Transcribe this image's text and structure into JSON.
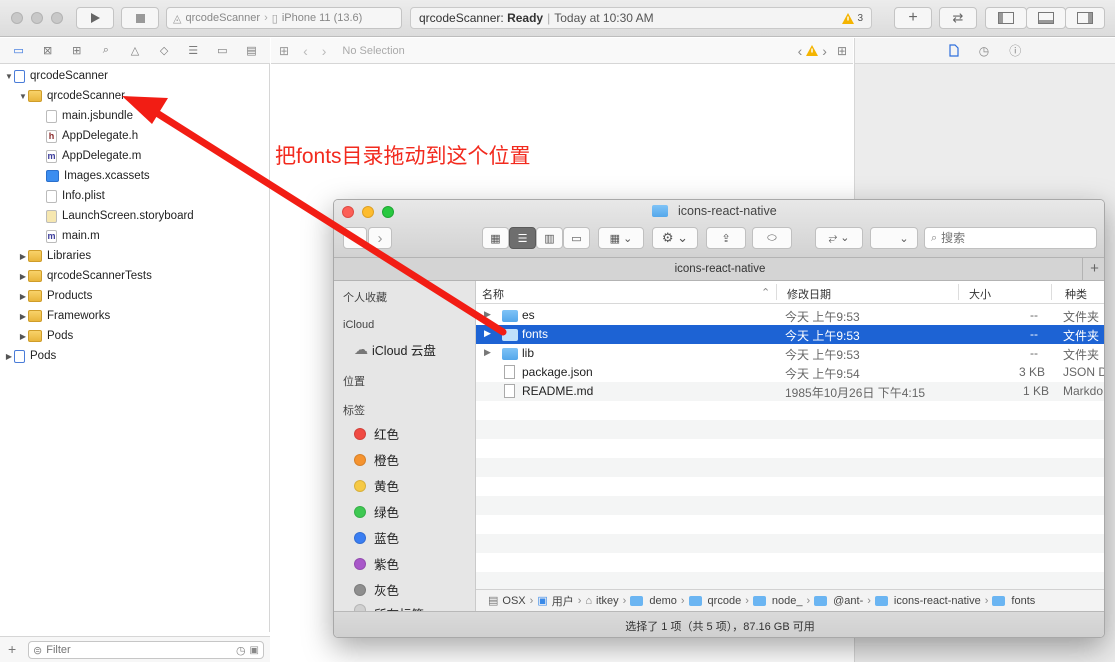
{
  "toolbar": {
    "scheme": "qrcodeScanner",
    "device": "iPhone 11 (13.6)",
    "status_project": "qrcodeScanner:",
    "status_state": "Ready",
    "status_time": "Today at 10:30 AM",
    "warning_count": "3"
  },
  "editor": {
    "no_selection": "No Selection"
  },
  "navigator": {
    "items": [
      {
        "label": "qrcodeScanner"
      },
      {
        "label": "qrcodeScanner"
      },
      {
        "label": "main.jsbundle"
      },
      {
        "label": "AppDelegate.h",
        "glyph": "h"
      },
      {
        "label": "AppDelegate.m",
        "glyph": "m"
      },
      {
        "label": "Images.xcassets"
      },
      {
        "label": "Info.plist"
      },
      {
        "label": "LaunchScreen.storyboard"
      },
      {
        "label": "main.m",
        "glyph": "m"
      },
      {
        "label": "Libraries"
      },
      {
        "label": "qrcodeScannerTests"
      },
      {
        "label": "Products"
      },
      {
        "label": "Frameworks"
      },
      {
        "label": "Pods"
      },
      {
        "label": "Pods"
      }
    ],
    "filter_placeholder": "Filter"
  },
  "annotation": "把fonts目录拖动到这个位置",
  "finder": {
    "title": "icons-react-native",
    "tab": "icons-react-native",
    "search_placeholder": "搜索",
    "sidebar": {
      "favorites": "个人收藏",
      "icloud_head": "iCloud",
      "icloud_drive": "iCloud 云盘",
      "locations": "位置",
      "tags_head": "标签",
      "tags": [
        {
          "label": "红色",
          "color": "#f04a42"
        },
        {
          "label": "橙色",
          "color": "#f5932f"
        },
        {
          "label": "黄色",
          "color": "#f6c944"
        },
        {
          "label": "绿色",
          "color": "#3ec852"
        },
        {
          "label": "蓝色",
          "color": "#3a7ef2"
        },
        {
          "label": "紫色",
          "color": "#a857c9"
        },
        {
          "label": "灰色",
          "color": "#8e8e8e"
        }
      ],
      "all_tags": "所有标签..."
    },
    "columns": {
      "name": "名称",
      "date": "修改日期",
      "size": "大小",
      "kind": "种类"
    },
    "rows": [
      {
        "name": "es",
        "date": "今天 上午9:53",
        "size": "--",
        "kind": "文件夹",
        "folder": true,
        "selected": false
      },
      {
        "name": "fonts",
        "date": "今天 上午9:53",
        "size": "--",
        "kind": "文件夹",
        "folder": true,
        "selected": true
      },
      {
        "name": "lib",
        "date": "今天 上午9:53",
        "size": "--",
        "kind": "文件夹",
        "folder": true,
        "selected": false
      },
      {
        "name": "package.json",
        "date": "今天 上午9:54",
        "size": "3 KB",
        "kind": "JSON D",
        "folder": false,
        "selected": false
      },
      {
        "name": "README.md",
        "date": "1985年10月26日 下午4:15",
        "size": "1 KB",
        "kind": "Markdo",
        "folder": false,
        "selected": false
      }
    ],
    "path": [
      "OSX",
      "用户",
      "itkey",
      "demo",
      "qrcode",
      "node_",
      "@ant-",
      "icons-react-native",
      "fonts"
    ],
    "status": "选择了 1 项（共 5 项），87.16 GB 可用"
  }
}
